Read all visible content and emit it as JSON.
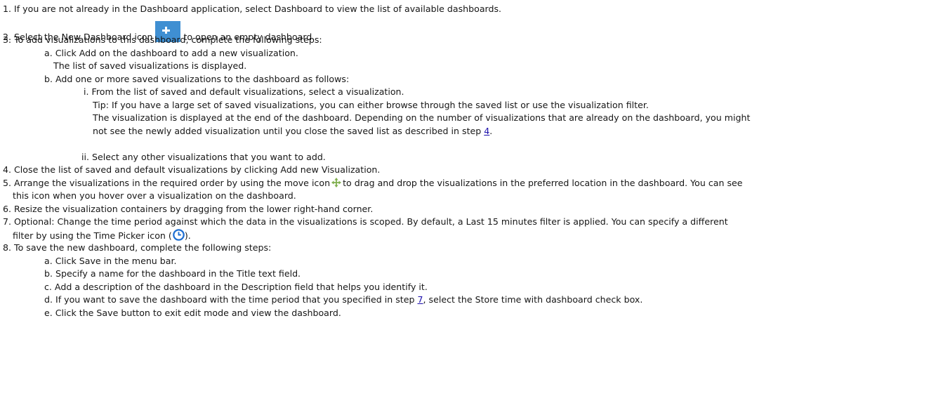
{
  "steps": {
    "s1": "1. If you are not already in the Dashboard application, select Dashboard to view the list of available dashboards.",
    "s2_pre": "2. Select the New Dashboard icon",
    "s2_post": "to open an empty dashboard.",
    "s3": "3. To add visualizations to this dashboard, complete the following steps:",
    "s3a": "a. Click Add on the dashboard to add a new visualization.",
    "s3a_note": "The list of saved visualizations is displayed.",
    "s3b": "b. Add one or more saved visualizations to the dashboard as follows:",
    "s3b_i": "i. From the list of saved and default visualizations, select a visualization.",
    "s3b_i_tip": "Tip: If you have a large set of saved visualizations, you can either browse through the saved list or use the visualization filter.",
    "s3b_i_note1": "The visualization is displayed at the end of the dashboard. Depending on the number of visualizations that are already on the dashboard, you might",
    "s3b_i_note2_pre": "not see the newly added visualization until you close the saved list as described in step",
    "s3b_i_note2_link": "4",
    "s3b_i_note2_post": ".",
    "s3b_ii": "ii. Select any other visualizations that you want to add.",
    "s4": "4. Close the list of saved and default visualizations by clicking Add new Visualization.",
    "s5_pre": "5. Arrange the visualizations in the required order by using the move icon",
    "s5_post": "to drag and drop the visualizations in the preferred location in the dashboard. You can see",
    "s5_cont": "this icon when you hover over a visualization on the dashboard.",
    "s6": "6. Resize the visualization containers by dragging from the lower right-hand corner.",
    "s7": "7. Optional: Change the time period against which the data in the visualizations is scoped. By default, a Last 15 minutes filter is applied. You can specify a different",
    "s7_cont_pre": "filter by using the Time Picker icon (",
    "s7_cont_post": ").",
    "s8": "8. To save the new dashboard, complete the following steps:",
    "s8a": "a. Click Save in the menu bar.",
    "s8b": "b. Specify a name for the dashboard in the Title text field.",
    "s8c": "c. Add a description of the dashboard in the Description field that helps you identify it.",
    "s8d_pre": "d. If you want to save the dashboard with the time period that you specified in step",
    "s8d_link": "7",
    "s8d_post": ", select the Store time with dashboard check box.",
    "s8e": "e. Click the Save button to exit edit mode and view the dashboard."
  },
  "icons": {
    "new_dashboard": "plus-icon",
    "move": "move-arrows-icon",
    "time_picker": "clock-icon",
    "accent": "#3f8fd2",
    "link_color": "#1a0dab"
  }
}
